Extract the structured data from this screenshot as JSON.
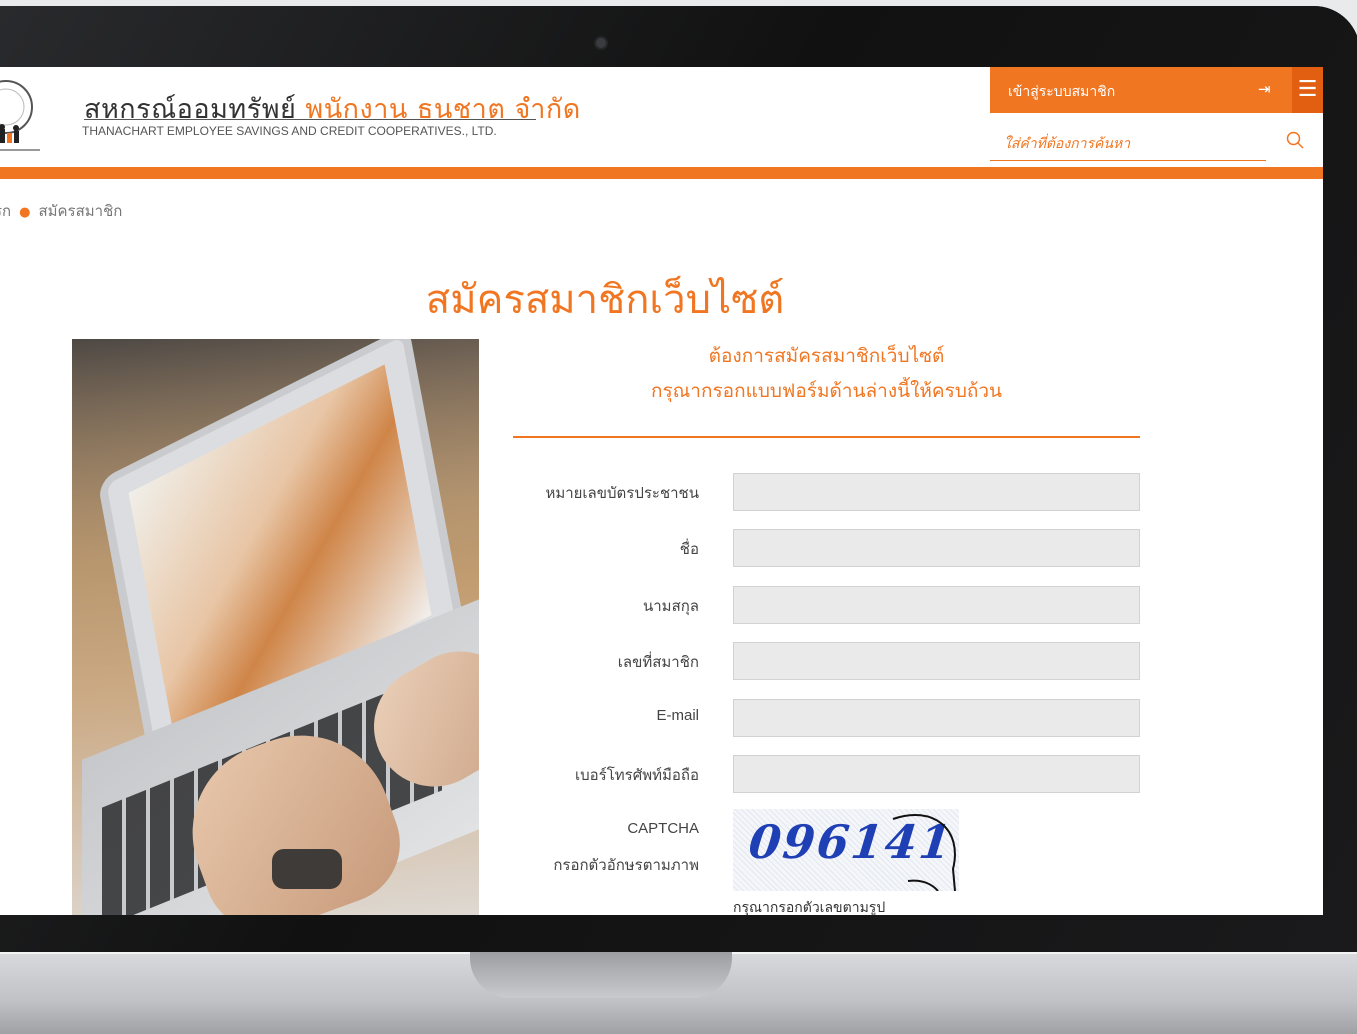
{
  "header": {
    "title_main": "สหกรณ์ออมทรัพย์",
    "title_accent": "พนักงาน ธนชาต จำกัด",
    "subtitle": "THANACHART EMPLOYEE SAVINGS AND CREDIT COOPERATIVES., LTD.",
    "login_label": "เข้าสู่ระบบสมาชิก",
    "login_icon": "login-icon",
    "menu_icon": "hamburger-menu-icon",
    "search_placeholder": "ใส่คำที่ต้องการค้นหา",
    "search_icon": "search-icon"
  },
  "breadcrumb": {
    "items": [
      "รก",
      "สมัครสมาชิก"
    ]
  },
  "page": {
    "title": "สมัครสมาชิกเว็บไซต์"
  },
  "form": {
    "heading_line1": "ต้องการสมัครสมาชิกเว็บไซต์",
    "heading_line2": "กรุณากรอกแบบฟอร์มด้านล่างนี้ให้ครบถ้วน",
    "fields": [
      {
        "label": "หมายเลขบัตรประชาชน",
        "value": ""
      },
      {
        "label": "ชื่อ",
        "value": ""
      },
      {
        "label": "นามสกุล",
        "value": ""
      },
      {
        "label": "เลขที่สมาชิก",
        "value": ""
      },
      {
        "label": "E-mail",
        "value": ""
      },
      {
        "label": "เบอร์โทรศัพท์มือถือ",
        "value": ""
      }
    ],
    "captcha_label": "CAPTCHA",
    "captcha_sub_label": "กรอกตัวอักษรตามภาพ",
    "captcha_text": "096141",
    "captcha_hint": "กรุณากรอกตัวเลขตามรูป"
  },
  "colors": {
    "accent": "#f07622",
    "accent_dark": "#e25f12",
    "input_bg": "#eaeaea"
  }
}
